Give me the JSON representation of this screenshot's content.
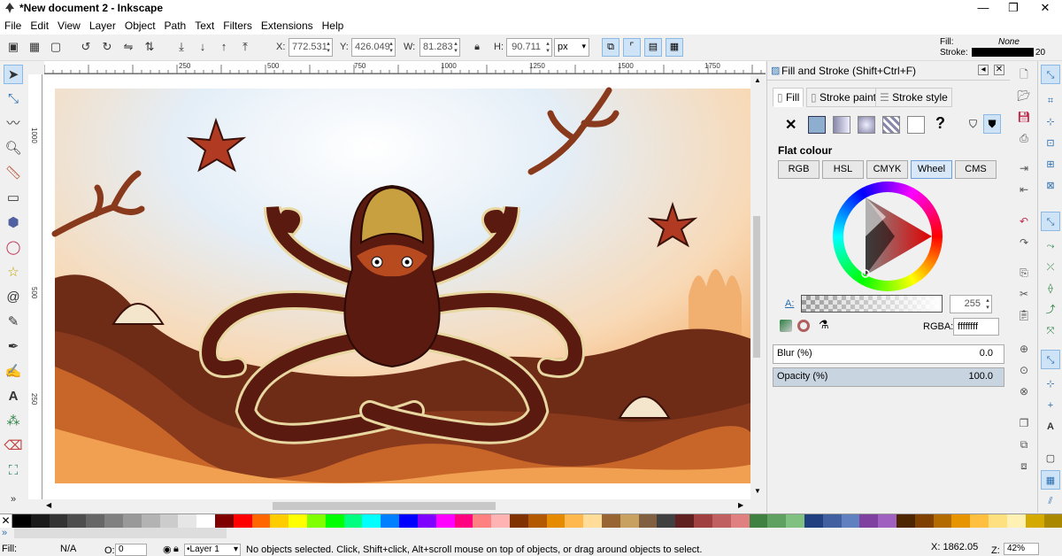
{
  "window": {
    "title": "*New document 2 - Inkscape",
    "controls": [
      "—",
      "❐",
      "✕"
    ]
  },
  "menu": [
    "File",
    "Edit",
    "View",
    "Layer",
    "Object",
    "Path",
    "Text",
    "Filters",
    "Extensions",
    "Help"
  ],
  "toolbar": {
    "x_label": "X:",
    "x_value": "772.531",
    "y_label": "Y:",
    "y_value": "426.049",
    "w_label": "W:",
    "w_value": "81.283",
    "h_label": "H:",
    "h_value": "90.711",
    "unit": "px"
  },
  "style_indicator": {
    "fill_label": "Fill:",
    "fill_value": "None",
    "stroke_label": "Stroke:",
    "stroke_width": "20"
  },
  "ruler": {
    "top_ticks": [
      "250",
      "500",
      "750",
      "1000",
      "1250",
      "1500",
      "1750"
    ],
    "left_ticks": [
      "1000",
      "500",
      "250"
    ]
  },
  "fill_stroke_panel": {
    "title": "Fill and Stroke (Shift+Ctrl+F)",
    "tabs": [
      "Fill",
      "Stroke paint",
      "Stroke style"
    ],
    "active_tab": "Fill",
    "fill_mode_section": "Flat colour",
    "color_modes": [
      "RGB",
      "HSL",
      "CMYK",
      "Wheel",
      "CMS"
    ],
    "active_color_mode": "Wheel",
    "alpha_label": "A:",
    "alpha_value": "255",
    "rgba_label": "RGBA:",
    "rgba_value": "ffffffff",
    "blur_label": "Blur (%)",
    "blur_value": "0.0",
    "opacity_label": "Opacity (%)",
    "opacity_value": "100.0",
    "opacity_fraction": 1.0
  },
  "status": {
    "fill_label": "Fill:",
    "fill_value": "N/A",
    "o_label": "O:",
    "o_value": "0",
    "layer": "•Layer 1",
    "message": "No objects selected. Click, Shift+click, Alt+scroll mouse on top of objects, or drag around objects to select.",
    "x_coord": "X: 1862.05",
    "z_label": "Z:",
    "zoom": "42%"
  },
  "colors": {
    "accent": "#2a6fb0",
    "canvas_sky": "#f7e6d0",
    "sand": "#f4a55a",
    "seabed": "#6e2b16",
    "octopus": "#5a1a10",
    "octopus_outline": "#e8d7a0"
  },
  "palette": [
    "#000000",
    "#1a1a1a",
    "#333333",
    "#4d4d4d",
    "#666666",
    "#808080",
    "#999999",
    "#b3b3b3",
    "#cccccc",
    "#e6e6e6",
    "#ffffff",
    "#800000",
    "#ff0000",
    "#ff6600",
    "#ffcc00",
    "#ffff00",
    "#80ff00",
    "#00ff00",
    "#00ff80",
    "#00ffff",
    "#0080ff",
    "#0000ff",
    "#8000ff",
    "#ff00ff",
    "#ff0080",
    "#ff8080",
    "#ffb3b3",
    "#803300",
    "#b35900",
    "#e68a00",
    "#ffb84d",
    "#ffdd99",
    "#996633",
    "#c8a060",
    "#806040",
    "#404040",
    "#602020",
    "#a04040",
    "#c06060",
    "#e08080",
    "#408040",
    "#60a060",
    "#80c080",
    "#204080",
    "#4060a0",
    "#6080c0",
    "#8040a0",
    "#a060c0",
    "#4d2600",
    "#804000",
    "#b36b00",
    "#e69500",
    "#ffc040",
    "#ffe080",
    "#fff0b3",
    "#d4aa00",
    "#aa8800"
  ]
}
